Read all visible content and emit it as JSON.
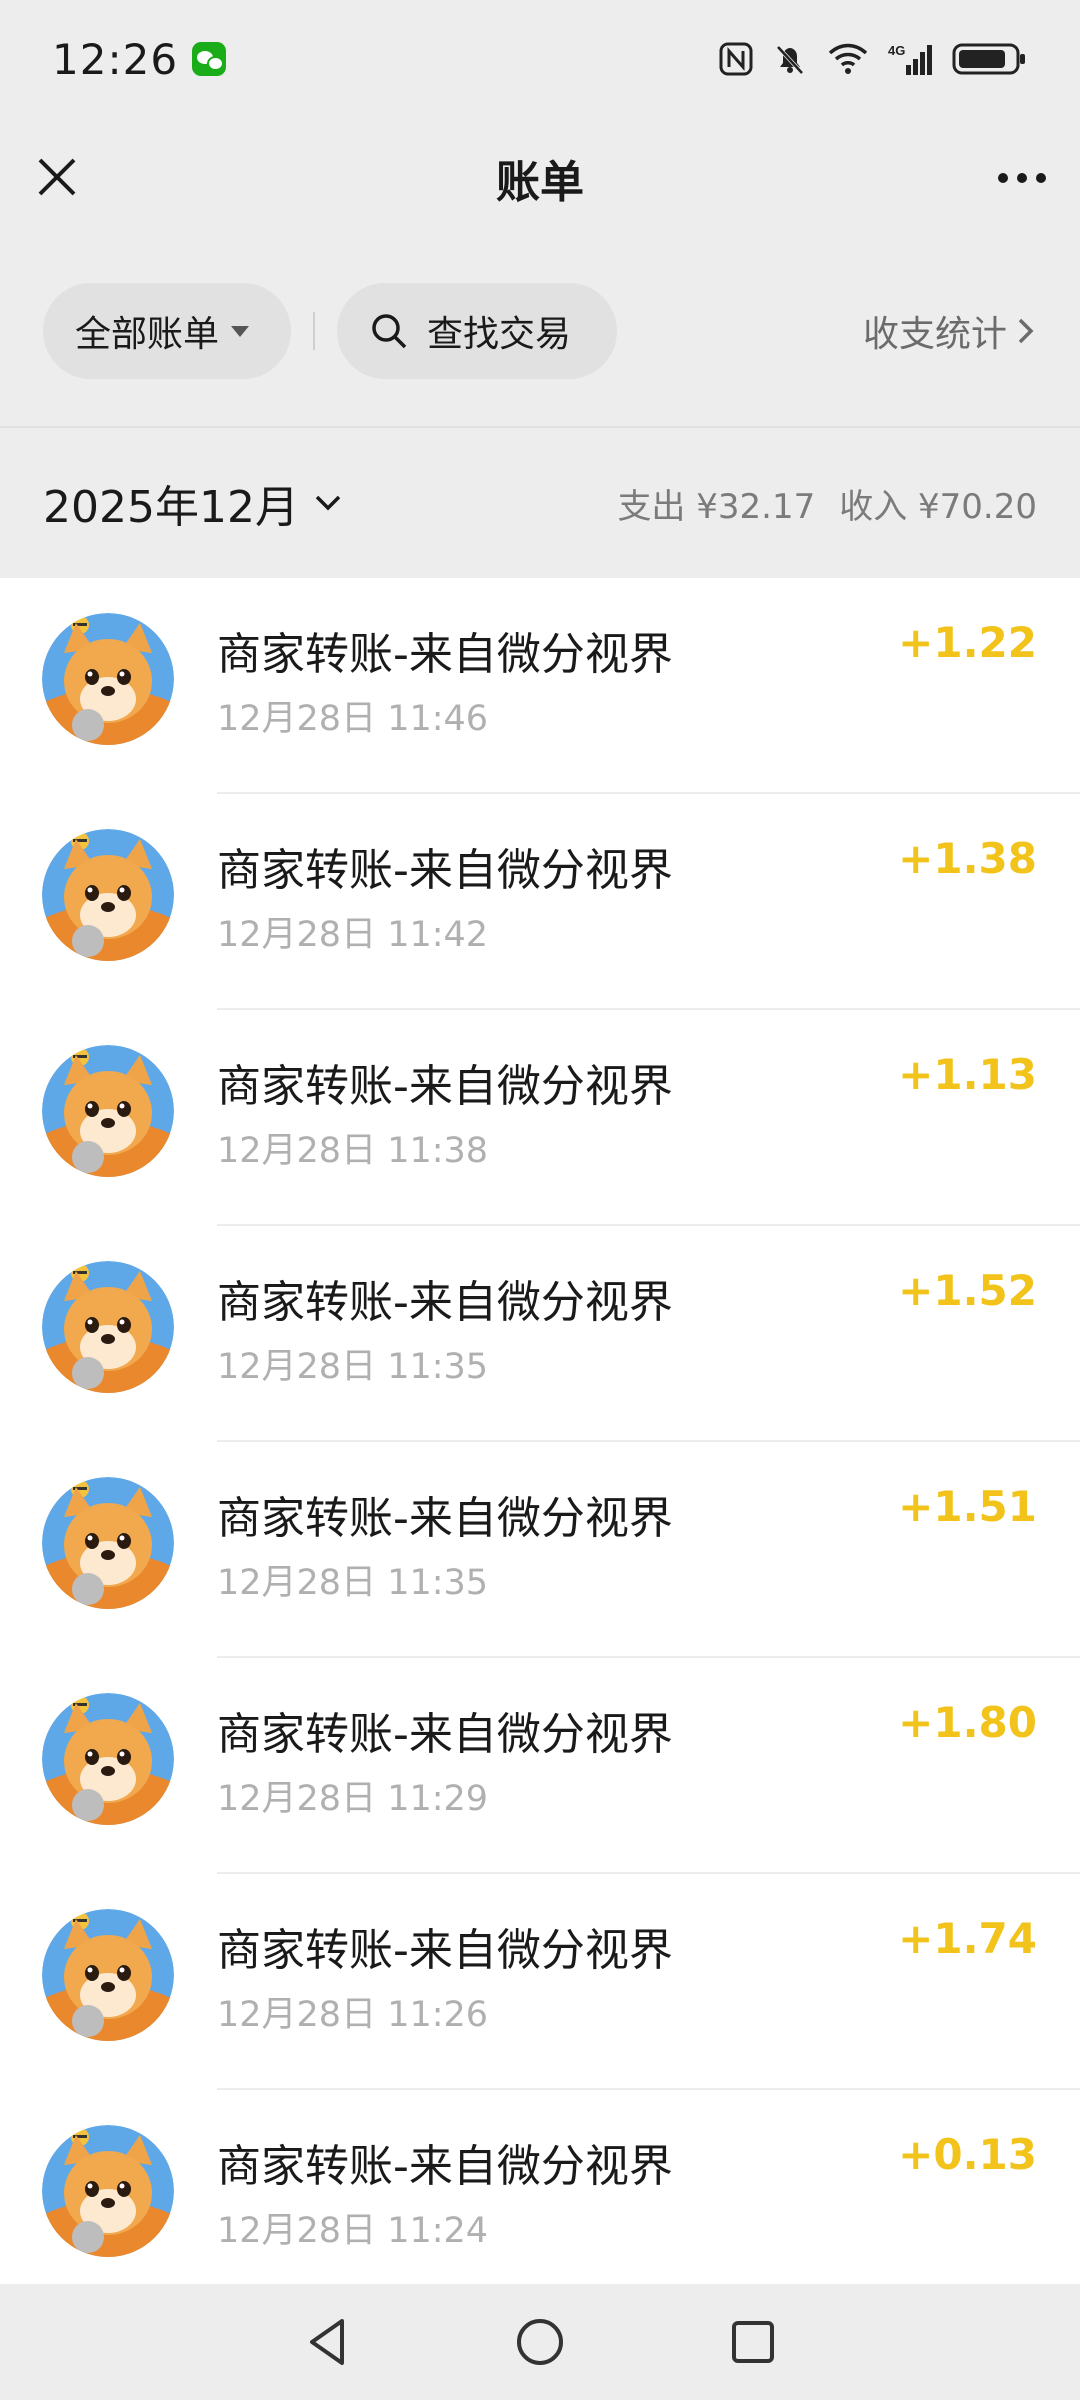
{
  "status_bar": {
    "time": "12:26",
    "network": "4G"
  },
  "nav": {
    "title": "账单"
  },
  "filters": {
    "all_bills_label": "全部账单",
    "search_label": "查找交易",
    "stats_label": "收支统计"
  },
  "month": {
    "label": "2025年12月",
    "expense_label": "支出",
    "expense_value": "¥32.17",
    "income_label": "收入",
    "income_value": "¥70.20"
  },
  "transactions": [
    {
      "title": "商家转账-来自微分视界",
      "time": "12月28日 11:46",
      "amount": "+1.22"
    },
    {
      "title": "商家转账-来自微分视界",
      "time": "12月28日 11:42",
      "amount": "+1.38"
    },
    {
      "title": "商家转账-来自微分视界",
      "time": "12月28日 11:38",
      "amount": "+1.13"
    },
    {
      "title": "商家转账-来自微分视界",
      "time": "12月28日 11:35",
      "amount": "+1.52"
    },
    {
      "title": "商家转账-来自微分视界",
      "time": "12月28日 11:35",
      "amount": "+1.51"
    },
    {
      "title": "商家转账-来自微分视界",
      "time": "12月28日 11:29",
      "amount": "+1.80"
    },
    {
      "title": "商家转账-来自微分视界",
      "time": "12月28日 11:26",
      "amount": "+1.74"
    },
    {
      "title": "商家转账-来自微分视界",
      "time": "12月28日 11:24",
      "amount": "+0.13"
    }
  ],
  "colors": {
    "income_amount": "#f2c31b",
    "background": "#ededed"
  }
}
